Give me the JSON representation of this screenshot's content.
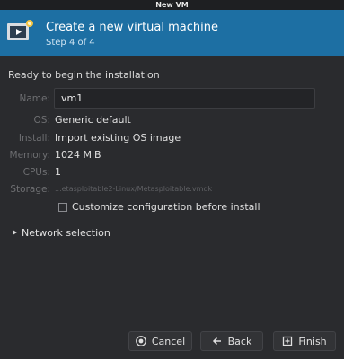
{
  "window": {
    "title": "New VM"
  },
  "header": {
    "title": "Create a new virtual machine",
    "step": "Step 4 of 4",
    "icon": "vm-monitor-icon",
    "accent": "#1d6fa3"
  },
  "summary": {
    "heading": "Ready to begin the installation",
    "name_label": "Name:",
    "name_value": "vm1",
    "os_label": "OS:",
    "os_value": "Generic default",
    "install_label": "Install:",
    "install_value": "Import existing OS image",
    "memory_label": "Memory:",
    "memory_value": "1024 MiB",
    "cpus_label": "CPUs:",
    "cpus_value": "1",
    "storage_label": "Storage:",
    "storage_value": "...etasploitable2-Linux/Metasploitable.vmdk"
  },
  "customize": {
    "label": "Customize configuration before install",
    "checked": false
  },
  "network": {
    "label": "Network selection",
    "expanded": false
  },
  "buttons": {
    "cancel": "Cancel",
    "back": "Back",
    "finish": "Finish"
  }
}
